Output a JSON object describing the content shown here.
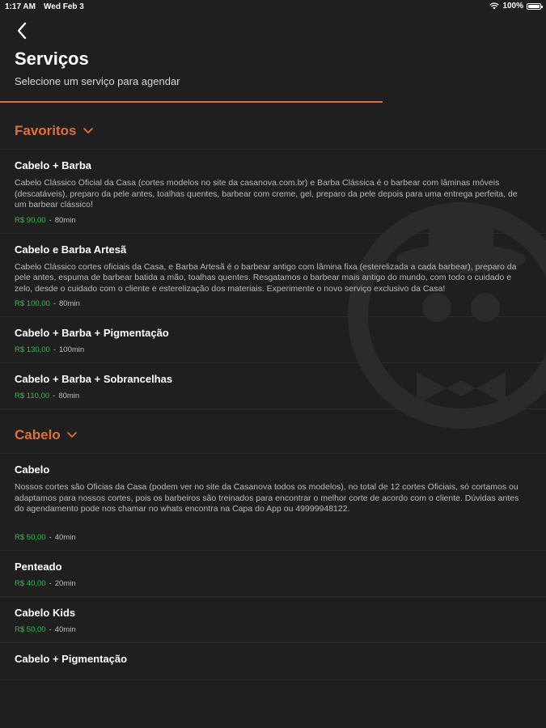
{
  "statusbar": {
    "time": "1:17 AM",
    "date": "Wed Feb 3",
    "battery": "100%"
  },
  "header": {
    "title": "Serviços",
    "subtitle": "Selecione um serviço para agendar"
  },
  "colors": {
    "background": "#1f1f1f",
    "accent": "#e0703a",
    "price": "#2fbf4a"
  },
  "sections": [
    {
      "title": "Favoritos",
      "services": [
        {
          "name": "Cabelo + Barba",
          "description": "Cabelo Clássico Oficial da Casa (cortes modelos no site da casanova.com.br) e Barba Clássica é o barbear com lâminas móveis (descatáveis), preparo da pele antes, toalhas quentes, barbear com creme, gel, preparo da pele depois para uma entrega perfeita, de um barbear clássico!",
          "price": "R$ 90,00",
          "duration": "80min"
        },
        {
          "name": "Cabelo e Barba Artesã",
          "description": "Cabelo Clássico cortes oficiais da Casa, e Barba Artesã é o barbear antigo com lâmina fixa (esterelizada a cada barbear), preparo da pele antes, espuma de barbear batida a mão, toalhas quentes. Resgatamos o barbear mais antigo do mundo, com todo o cuidado e zelo, desde o cuidado com o cliente e esterelização dos materiais. Experimente o novo serviço exclusivo da Casa!",
          "price": "R$ 100,00",
          "duration": "80min"
        },
        {
          "name": "Cabelo + Barba + Pigmentação",
          "description": "",
          "price": "R$ 130,00",
          "duration": "100min"
        },
        {
          "name": "Cabelo + Barba + Sobrancelhas",
          "description": "",
          "price": "R$ 110,00",
          "duration": "80min"
        }
      ]
    },
    {
      "title": "Cabelo",
      "services": [
        {
          "name": "Cabelo",
          "description": "Nossos cortes são Oficias da Casa (podem ver no site da Casanova todos os modelos), no total de 12 cortes Oficiais, só cortamos ou adaptamos para nossos cortes, pois os barbeiros são treinados para encontrar o melhor corte de acordo com o cliente. Dúvidas antes do agendamento pode nos chamar no whats encontra na Capa do App ou 49999948122.",
          "price": "R$ 50,00",
          "duration": "40min"
        },
        {
          "name": "Penteado",
          "description": "",
          "price": "R$ 40,00",
          "duration": "20min"
        },
        {
          "name": "Cabelo Kids",
          "description": "",
          "price": "R$ 50,00",
          "duration": "40min"
        },
        {
          "name": "Cabelo + Pigmentação",
          "description": "",
          "price": "",
          "duration": ""
        }
      ]
    }
  ]
}
